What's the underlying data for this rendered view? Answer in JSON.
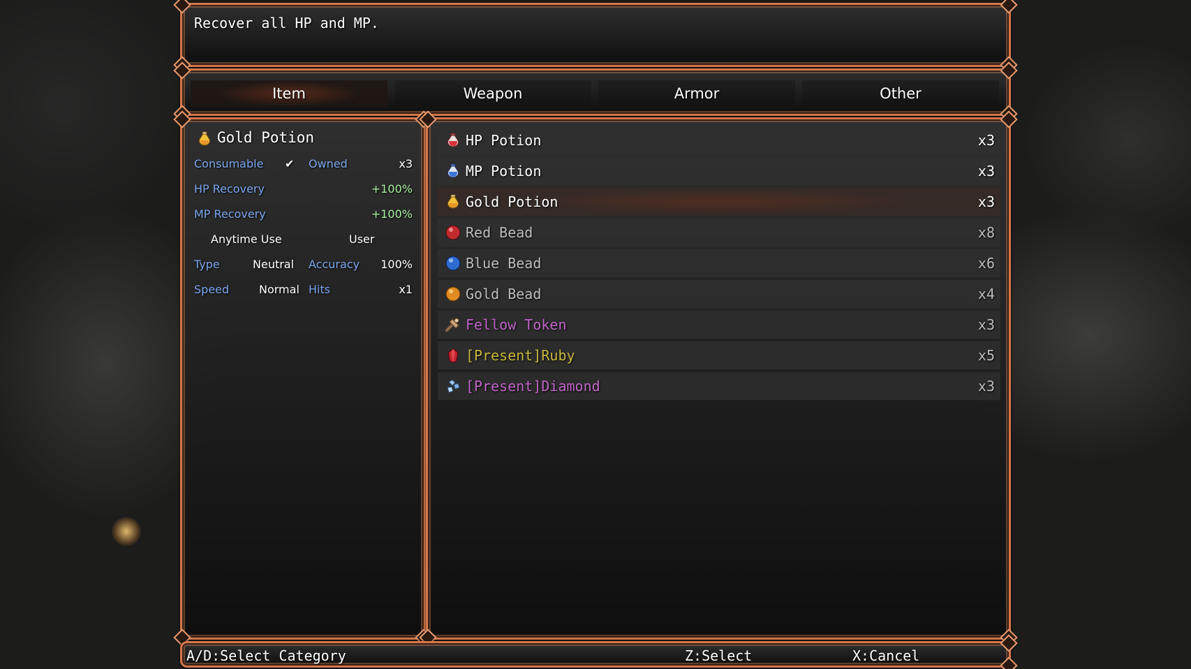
{
  "help": {
    "text": "Recover all HP and MP."
  },
  "categories": [
    {
      "label": "Item",
      "active": true
    },
    {
      "label": "Weapon",
      "active": false
    },
    {
      "label": "Armor",
      "active": false
    },
    {
      "label": "Other",
      "active": false
    }
  ],
  "status": {
    "name": "Gold Potion",
    "icon": "gold-potion-icon",
    "consumable_label": "Consumable",
    "consumable_check": "✔",
    "owned_label": "Owned",
    "owned_value": "x3",
    "hp_label": "HP Recovery",
    "hp_value": "+100%",
    "mp_label": "MP Recovery",
    "mp_value": "+100%",
    "occasion": "Anytime Use",
    "scope": "User",
    "type_label": "Type",
    "type_value": "Neutral",
    "accuracy_label": "Accuracy",
    "accuracy_value": "100%",
    "speed_label": "Speed",
    "speed_value": "Normal",
    "hits_label": "Hits",
    "hits_value": "x1"
  },
  "items": [
    {
      "name": "HP Potion",
      "count": "x3",
      "icon": "red-potion-icon",
      "color": "#ffffff"
    },
    {
      "name": "MP Potion",
      "count": "x3",
      "icon": "blue-potion-icon",
      "color": "#ffffff"
    },
    {
      "name": "Gold Potion",
      "count": "x3",
      "icon": "gold-potion-icon",
      "color": "#ffffff",
      "selected": true
    },
    {
      "name": "Red Bead",
      "count": "x8",
      "icon": "red-bead-icon",
      "color": "#bdbdbd"
    },
    {
      "name": "Blue Bead",
      "count": "x6",
      "icon": "blue-bead-icon",
      "color": "#bdbdbd"
    },
    {
      "name": "Gold Bead",
      "count": "x4",
      "icon": "gold-bead-icon",
      "color": "#bdbdbd"
    },
    {
      "name": "Fellow Token",
      "count": "x3",
      "icon": "token-icon",
      "color": "#c066c8"
    },
    {
      "name": "[Present]Ruby",
      "count": "x5",
      "icon": "ruby-icon",
      "color": "#c8b83c"
    },
    {
      "name": "[Present]Diamond",
      "count": "x3",
      "icon": "diamond-icon",
      "color": "#c066c8"
    }
  ],
  "controls": {
    "category": "A/D:Select Category",
    "select": "Z:Select",
    "cancel": "X:Cancel"
  },
  "colors": {
    "frame": "#d5774a",
    "param_label": "#7ba7ee",
    "positive": "#a8f0a0"
  }
}
